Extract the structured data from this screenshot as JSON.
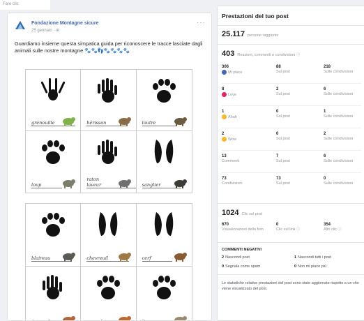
{
  "topbar": {
    "text": "Fare clic"
  },
  "post": {
    "page_name": "Fondazione Montagne sicure",
    "date": "25 gennaio · ⊕",
    "menu": "···",
    "text": "Guardiamo insieme questa simpatica guida per riconoscere le tracce lasciate dagli animali sulle nostre montagne 🐾🐾👣🐾🐾🐾🐾",
    "sheet1": [
      {
        "caption": "grenouille",
        "track": "frog",
        "animal_color": "#7fb24a"
      },
      {
        "caption": "hérisson",
        "track": "hedgehog",
        "animal_color": "#8a6b4a"
      },
      {
        "caption": "loutre",
        "track": "otter",
        "animal_color": "#6b5a3e"
      },
      {
        "caption": "loup",
        "track": "wolf",
        "animal_color": "#7d7d6d"
      },
      {
        "caption": "raton laveur",
        "track": "raccoon",
        "animal_color": "#6f6f6f"
      },
      {
        "caption": "sanglier",
        "track": "boar",
        "animal_color": "#3e3a36"
      }
    ],
    "sheet2": [
      {
        "caption": "blaireau",
        "track": "badger",
        "animal_color": "#5c5a55"
      },
      {
        "caption": "chevreuil",
        "track": "deer",
        "animal_color": "#a07848"
      },
      {
        "caption": "cerf",
        "track": "stag",
        "animal_color": "#8a5a32"
      },
      {
        "caption": "écureuil",
        "track": "squirrel",
        "animal_color": "#b0653a"
      },
      {
        "caption": "renard",
        "track": "fox",
        "animal_color": "#c0692e"
      },
      {
        "caption": "lynx",
        "track": "lynx",
        "animal_color": "#9c8a6e"
      }
    ]
  },
  "panel": {
    "title": "Prestazioni del tuo post",
    "reach_value": "25.117",
    "reach_label": "persone raggiunte",
    "engage_value": "403",
    "engage_label": "Reazioni, commenti e condivisioni ⓘ",
    "reaction_rows": [
      {
        "icon_color": "#4267b2",
        "label": "Mi piace",
        "total": "306",
        "post": "88",
        "post_label": "Sul post",
        "shares": "218",
        "shares_label": "Sulle condivisioni"
      },
      {
        "icon_color": "#e0245e",
        "label": "Love",
        "total": "8",
        "post": "2",
        "post_label": "Sul post",
        "shares": "6",
        "shares_label": "Sulle condivisioni"
      },
      {
        "icon_color": "#f7b928",
        "label": "Ahah",
        "total": "1",
        "post": "0",
        "post_label": "Sul post",
        "shares": "1",
        "shares_label": "Sulle condivisioni"
      },
      {
        "icon_color": "#f7b928",
        "label": "Wow",
        "total": "2",
        "post": "0",
        "post_label": "Sul post",
        "shares": "2",
        "shares_label": "Sulle condivisioni"
      },
      {
        "icon_color": "",
        "label": "Commenti",
        "total": "13",
        "post": "7",
        "post_label": "Sul post",
        "shares": "6",
        "shares_label": "Sulle condivisioni"
      },
      {
        "icon_color": "",
        "label": "Condivisioni",
        "total": "73",
        "post": "73",
        "post_label": "Sul post",
        "shares": "0",
        "shares_label": "Sulle condivisioni"
      }
    ],
    "clicks_value": "1024",
    "clicks_label": "Clic sul post",
    "clicks": [
      {
        "value": "670",
        "label": "Visualizzazioni della foto"
      },
      {
        "value": "0",
        "label": "Clic sul link ⓘ"
      },
      {
        "value": "354",
        "label": "Altri clic ⓘ"
      }
    ],
    "negative_title": "COMMENTI NEGATIVI",
    "negative": [
      {
        "value": "2",
        "label": "Nascondi post"
      },
      {
        "value": "1",
        "label": "Nascondi tutti i post"
      },
      {
        "value": "0",
        "label": "Segnala come spam"
      },
      {
        "value": "0",
        "label": "Non mi piace più"
      }
    ],
    "footer": "Le statistiche relative prestazioni del post sono state aggiornate rispetto a un che viene visualizzato del post."
  }
}
